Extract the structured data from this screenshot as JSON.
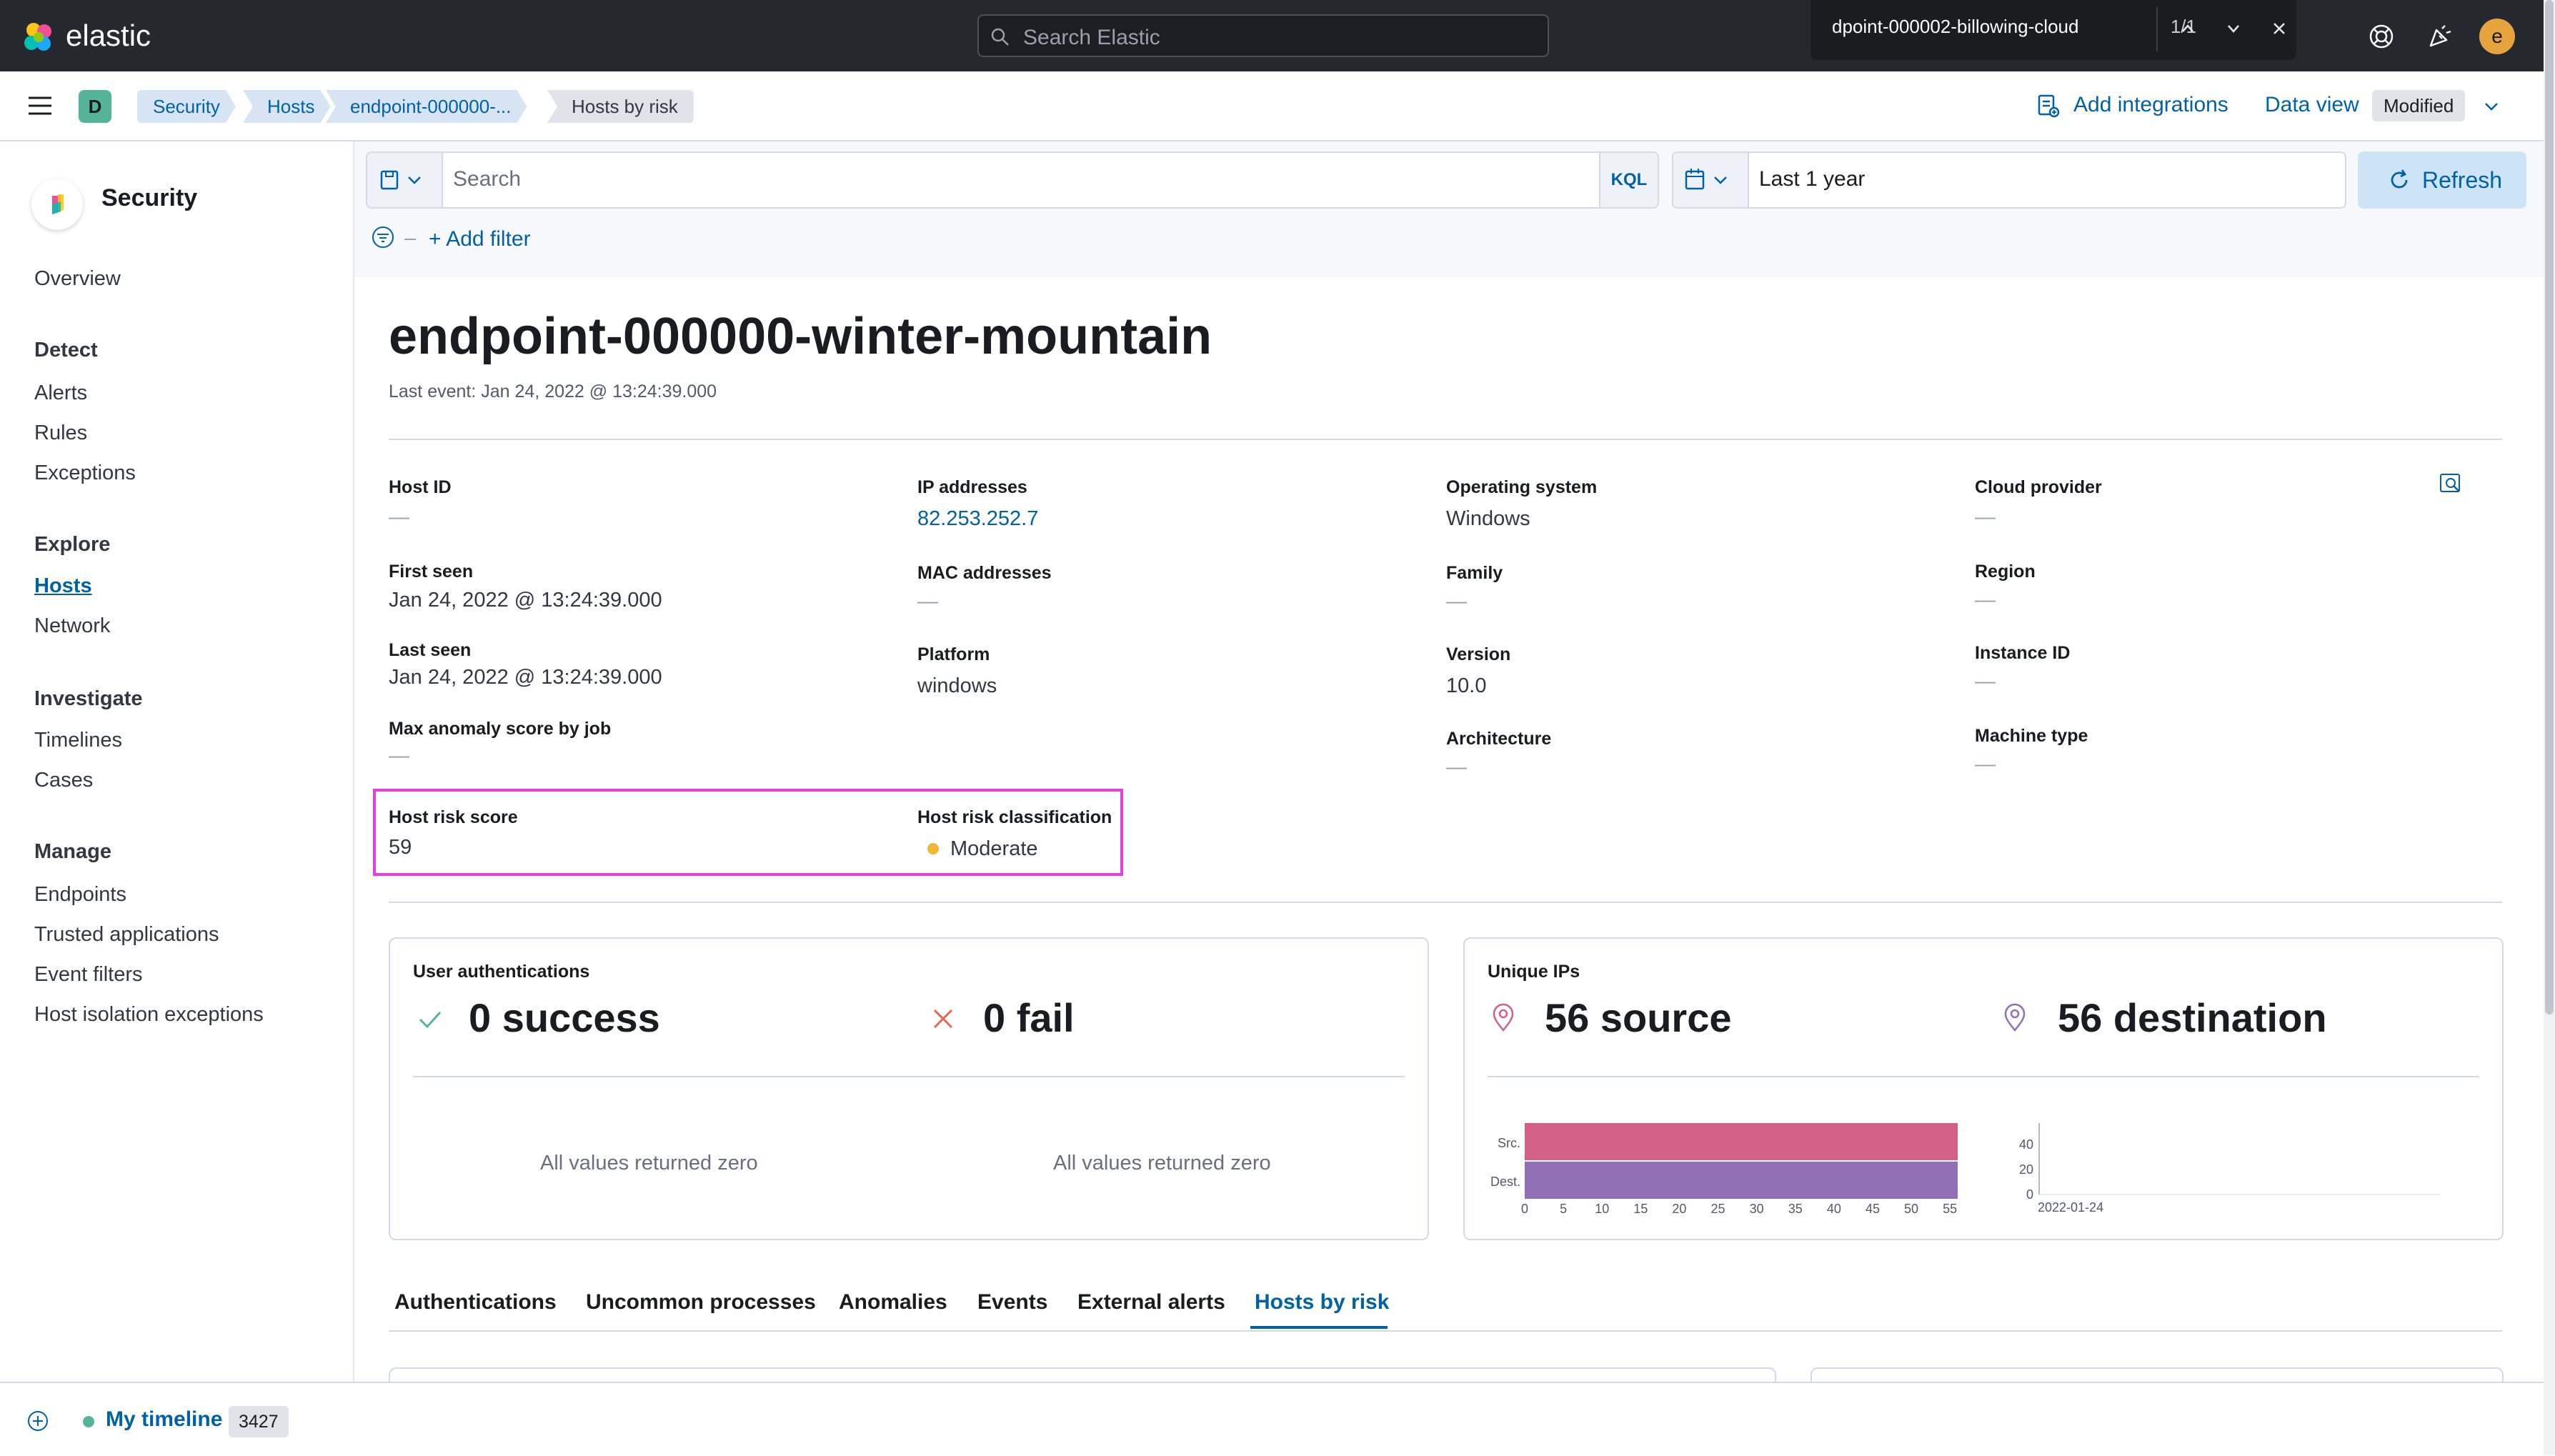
{
  "header": {
    "logo_text": "elastic",
    "search_placeholder": "Search Elastic",
    "find_bar": {
      "query": "dpoint-000002-billowing-cloud",
      "count": "1/1"
    },
    "avatar_initial": "e"
  },
  "breadcrumbs": {
    "space_initial": "D",
    "items": [
      {
        "label": "Security"
      },
      {
        "label": "Hosts"
      },
      {
        "label": "endpoint-000000-..."
      },
      {
        "label": "Hosts by risk"
      }
    ],
    "add_integrations": "Add integrations",
    "data_view": "Data view",
    "modified": "Modified"
  },
  "sidebar": {
    "title": "Security",
    "overview": "Overview",
    "sections": [
      {
        "heading": "Detect",
        "items": [
          "Alerts",
          "Rules",
          "Exceptions"
        ]
      },
      {
        "heading": "Explore",
        "items": [
          "Hosts",
          "Network"
        ]
      },
      {
        "heading": "Investigate",
        "items": [
          "Timelines",
          "Cases"
        ]
      },
      {
        "heading": "Manage",
        "items": [
          "Endpoints",
          "Trusted applications",
          "Event filters",
          "Host isolation exceptions"
        ]
      }
    ]
  },
  "query_bar": {
    "placeholder": "Search",
    "language": "KQL",
    "date_range": "Last 1 year",
    "refresh_label": "Refresh",
    "add_filter": "+ Add filter"
  },
  "host": {
    "name": "endpoint-000000-winter-mountain",
    "last_event": "Last event: Jan 24, 2022 @ 13:24:39.000",
    "details": {
      "host_id": {
        "label": "Host ID",
        "value": "—"
      },
      "first_seen": {
        "label": "First seen",
        "value": "Jan 24, 2022 @ 13:24:39.000"
      },
      "last_seen": {
        "label": "Last seen",
        "value": "Jan 24, 2022 @ 13:24:39.000"
      },
      "max_anomaly": {
        "label": "Max anomaly score by job",
        "value": "—"
      },
      "ip_addresses": {
        "label": "IP addresses",
        "value": "82.253.252.7"
      },
      "mac_addresses": {
        "label": "MAC addresses",
        "value": "—"
      },
      "platform": {
        "label": "Platform",
        "value": "windows"
      },
      "os": {
        "label": "Operating system",
        "value": "Windows"
      },
      "family": {
        "label": "Family",
        "value": "—"
      },
      "version": {
        "label": "Version",
        "value": "10.0"
      },
      "architecture": {
        "label": "Architecture",
        "value": "—"
      },
      "cloud_provider": {
        "label": "Cloud provider",
        "value": "—"
      },
      "region": {
        "label": "Region",
        "value": "—"
      },
      "instance_id": {
        "label": "Instance ID",
        "value": "—"
      },
      "machine_type": {
        "label": "Machine type",
        "value": "—"
      }
    },
    "risk": {
      "score_label": "Host risk score",
      "score": "59",
      "classification_label": "Host risk classification",
      "classification": "Moderate"
    }
  },
  "kpis": {
    "user_auth": {
      "title": "User authentications",
      "success": "0 success",
      "fail": "0 fail",
      "success_empty": "All values returned zero",
      "fail_empty": "All values returned zero"
    },
    "unique_ips": {
      "title": "Unique IPs",
      "source": "56 source",
      "destination": "56 destination",
      "bar_labels": {
        "src": "Src.",
        "dest": "Dest."
      },
      "x_ticks": [
        "0",
        "5",
        "10",
        "15",
        "20",
        "25",
        "30",
        "35",
        "40",
        "45",
        "50",
        "55"
      ],
      "y_ticks": [
        "40",
        "20",
        "0"
      ],
      "date_label": "2022-01-24"
    }
  },
  "chart_data": {
    "type": "bar",
    "orientation": "horizontal",
    "categories": [
      "Src.",
      "Dest."
    ],
    "values": [
      56,
      56
    ],
    "xlim": [
      0,
      56
    ],
    "colors": [
      "#d36086",
      "#9170b8"
    ]
  },
  "tabs": [
    {
      "label": "Authentications",
      "active": false
    },
    {
      "label": "Uncommon processes",
      "active": false
    },
    {
      "label": "Anomalies",
      "active": false
    },
    {
      "label": "Events",
      "active": false
    },
    {
      "label": "External alerts",
      "active": false
    },
    {
      "label": "Hosts by risk",
      "active": true
    }
  ],
  "timeline": {
    "name": "My timeline",
    "count": "3427"
  },
  "colors": {
    "accent": "#0061a6",
    "highlight": "#e83ee0",
    "moderate": "#f1b632"
  }
}
